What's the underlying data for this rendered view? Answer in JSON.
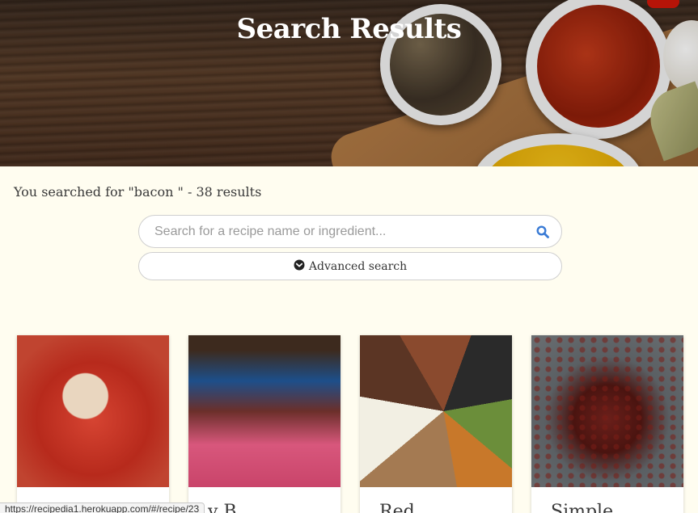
{
  "hero": {
    "title": "Search Results"
  },
  "results": {
    "summary": "You searched for \"bacon \" - 38 results"
  },
  "search": {
    "placeholder": "Search for a recipe name or ingredient...",
    "value": "",
    "advanced_label": "Advanced search"
  },
  "cards": [
    {
      "title": ""
    },
    {
      "title": "y B"
    },
    {
      "title": "Red"
    },
    {
      "title": "Simple"
    }
  ],
  "status_bar": {
    "url": "https://recipedia1.herokuapp.com/#/recipe/23"
  },
  "colors": {
    "accent": "#3a7bd5",
    "background": "#fffdf0"
  }
}
